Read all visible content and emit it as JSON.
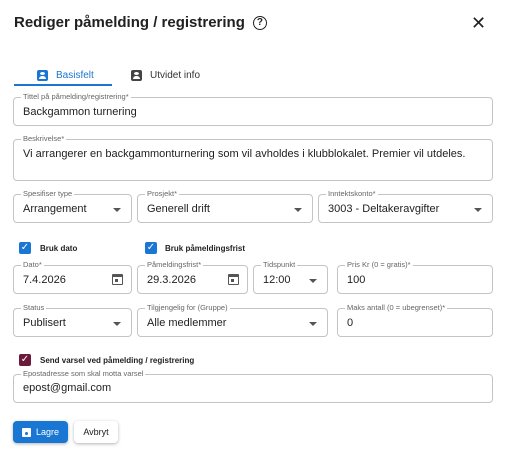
{
  "dialog": {
    "title": "Rediger påmelding / registrering",
    "help_glyph": "?",
    "close_glyph": "✕"
  },
  "tabs": [
    {
      "label": "Basisfelt",
      "icon": "person-badge-icon",
      "active": true
    },
    {
      "label": "Utvidet info",
      "icon": "person-badge-icon",
      "active": false
    }
  ],
  "fields": {
    "title": {
      "label": "Tittel på påmelding/registrering*",
      "value": "Backgammon turnering"
    },
    "description": {
      "label": "Beskrivelse*",
      "value": "Vi arrangerer en backgammonturnering som vil avholdes i klubblokalet. Premier vil utdeles."
    },
    "type": {
      "label": "Spesifiser type",
      "value": "Arrangement"
    },
    "project": {
      "label": "Prosjekt*",
      "value": "Generell drift"
    },
    "income_account": {
      "label": "Inntektskonto*",
      "value": "3003 - Deltakeravgifter"
    },
    "date": {
      "label": "Dato*",
      "value": "7.4.2026"
    },
    "deadline": {
      "label": "Påmeldingsfrist*",
      "value": "29.3.2026"
    },
    "time": {
      "label": "Tidspunkt",
      "value": "12:00"
    },
    "price": {
      "label": "Pris Kr (0 = gratis)*",
      "value": "100"
    },
    "status": {
      "label": "Status",
      "value": "Publisert"
    },
    "group": {
      "label": "Tilgjengelig for (Gruppe)",
      "value": "Alle medlemmer"
    },
    "max_count": {
      "label": "Maks antall (0 = ubegrenset)*",
      "value": "0"
    },
    "notify_email": {
      "label": "Epostadresse som skal motta varsel",
      "value": "epost@gmail.com"
    }
  },
  "checkboxes": {
    "use_date": {
      "label": "Bruk dato",
      "checked": true
    },
    "use_deadline": {
      "label": "Bruk påmeldingsfrist",
      "checked": true
    },
    "send_notification": {
      "label": "Send varsel ved påmelding / registrering",
      "checked": true
    }
  },
  "buttons": {
    "save": "Lagre",
    "cancel": "Avbryt"
  },
  "colors": {
    "primary": "#1976d2",
    "notify_checkbox": "#6a1b3a"
  }
}
